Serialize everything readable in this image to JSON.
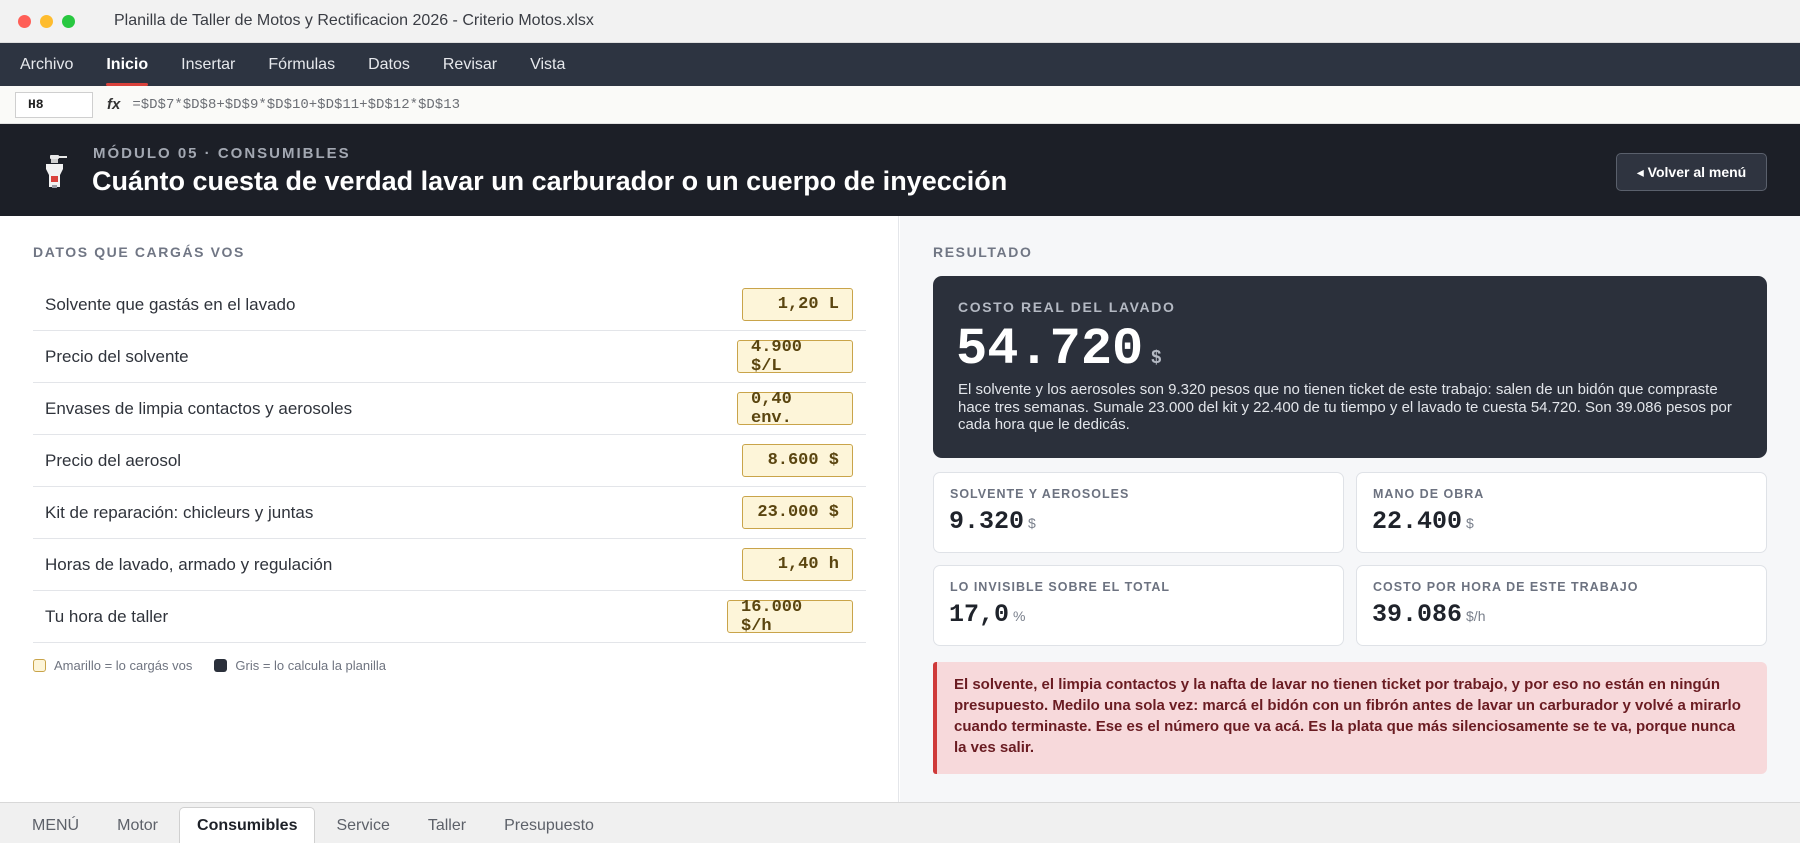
{
  "window": {
    "title": "Planilla de Taller de Motos y Rectificacion 2026 - Criterio Motos.xlsx"
  },
  "ribbon": {
    "tabs": [
      "Archivo",
      "Inicio",
      "Insertar",
      "Fórmulas",
      "Datos",
      "Revisar",
      "Vista"
    ],
    "active": "Inicio"
  },
  "formula_bar": {
    "cell": "H8",
    "fx": "fx",
    "formula": "=$D$7*$D$8+$D$9*$D$10+$D$11+$D$12*$D$13"
  },
  "module": {
    "kicker": "MÓDULO 05 · CONSUMIBLES",
    "title": "Cuánto cuesta de verdad lavar un carburador o un cuerpo de inyección",
    "back_label": "◂ Volver al menú",
    "icon": "spray-can-icon"
  },
  "inputs_section": {
    "title": "DATOS QUE CARGÁS VOS",
    "rows": [
      {
        "label": "Solvente que gastás en el lavado",
        "value": "1,20 L"
      },
      {
        "label": "Precio del solvente",
        "value": "4.900 $/L"
      },
      {
        "label": "Envases de limpia contactos y aerosoles",
        "value": "0,40 env."
      },
      {
        "label": "Precio del aerosol",
        "value": "8.600 $"
      },
      {
        "label": "Kit de reparación: chicleurs y juntas",
        "value": "23.000 $"
      },
      {
        "label": "Horas de lavado, armado y regulación",
        "value": "1,40 h"
      },
      {
        "label": "Tu hora de taller",
        "value": "16.000 $/h"
      }
    ],
    "legend": {
      "yellow": "Amarillo = lo cargás vos",
      "gray": "Gris = lo calcula la planilla"
    }
  },
  "result_section": {
    "title": "RESULTADO",
    "main": {
      "label": "COSTO REAL DEL LAVADO",
      "value": "54.720",
      "unit": "$",
      "description": "El solvente y los aerosoles son 9.320 pesos que no tienen ticket de este trabajo: salen de un bidón que compraste hace tres semanas. Sumale 23.000 del kit y 22.400 de tu tiempo y el lavado te cuesta 54.720. Son 39.086 pesos por cada hora que le dedicás."
    },
    "cards": [
      {
        "label": "SOLVENTE Y AEROSOLES",
        "value": "9.320",
        "unit": "$"
      },
      {
        "label": "MANO DE OBRA",
        "value": "22.400",
        "unit": "$"
      },
      {
        "label": "LO INVISIBLE SOBRE EL TOTAL",
        "value": "17,0",
        "unit": "%"
      },
      {
        "label": "COSTO POR HORA DE ESTE TRABAJO",
        "value": "39.086",
        "unit": "$/h"
      }
    ],
    "alert": "El solvente, el limpia contactos y la nafta de lavar no tienen ticket por trabajo, y por eso no están en ningún presupuesto. Medilo una sola vez: marcá el bidón con un fibrón antes de lavar un carburador y volvé a mirarlo cuando terminaste. Ese es el número que va acá. Es la plata que más silenciosamente se te va, porque nunca la ves salir."
  },
  "sheet_tabs": {
    "tabs": [
      "MENÚ",
      "Motor",
      "Consumibles",
      "Service",
      "Taller",
      "Presupuesto"
    ],
    "active": "Consumibles"
  },
  "colors": {
    "accent_red": "#d9413b",
    "input_fill": "#fdf5d9",
    "input_border": "#c9a44a",
    "dark_card": "#2b303b",
    "header": "#1c1f27"
  }
}
